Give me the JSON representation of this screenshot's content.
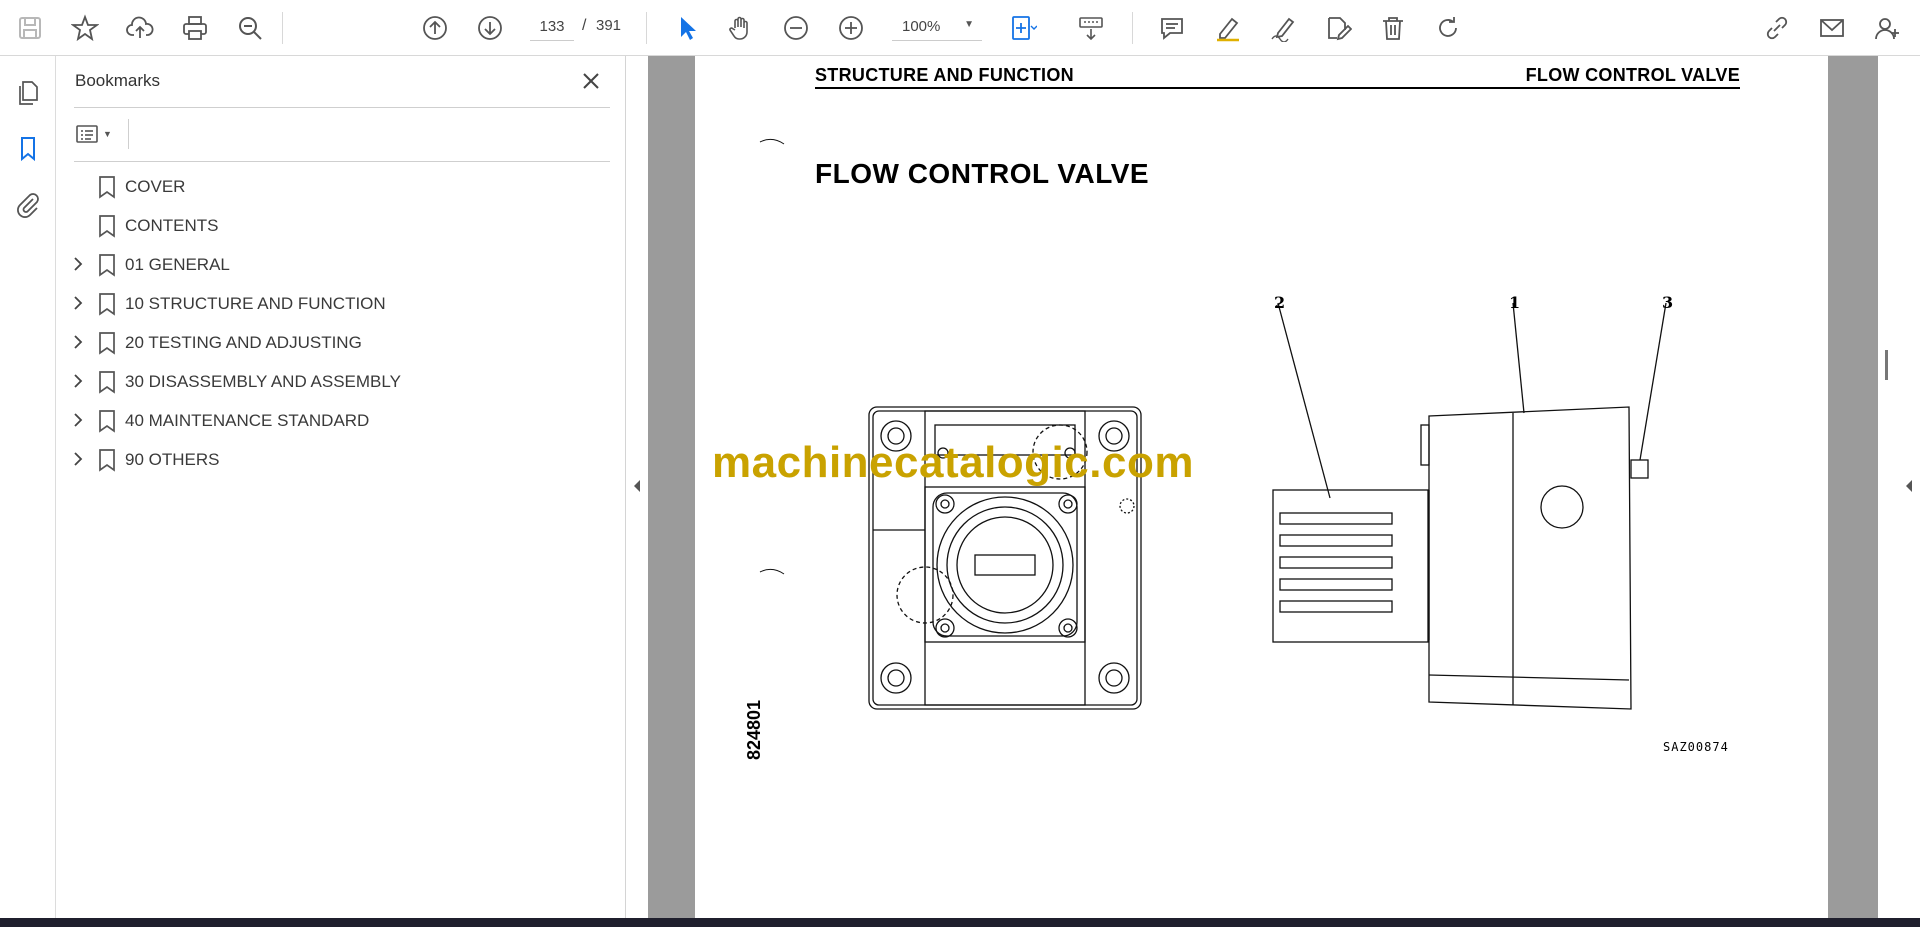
{
  "toolbar": {
    "current_page": "133",
    "page_separator": "/",
    "total_pages": "391",
    "zoom": "100%"
  },
  "panel": {
    "title": "Bookmarks"
  },
  "bookmarks": [
    {
      "label": "COVER",
      "expandable": false
    },
    {
      "label": "CONTENTS",
      "expandable": false
    },
    {
      "label": "01 GENERAL",
      "expandable": true
    },
    {
      "label": "10 STRUCTURE AND FUNCTION",
      "expandable": true
    },
    {
      "label": "20 TESTING AND ADJUSTING",
      "expandable": true
    },
    {
      "label": "30 DISASSEMBLY AND ASSEMBLY",
      "expandable": true
    },
    {
      "label": "40 MAINTENANCE STANDARD",
      "expandable": true
    },
    {
      "label": "90 OTHERS",
      "expandable": true
    }
  ],
  "document": {
    "header_left": "STRUCTURE AND FUNCTION",
    "header_right": "FLOW CONTROL VALVE",
    "title": "FLOW CONTROL VALVE",
    "watermark": "machinecatalogic.com",
    "figure_ref": "SAZ00874",
    "page_code": "824801",
    "callouts": {
      "c1": "1",
      "c2": "2",
      "c3": "3"
    }
  },
  "colors": {
    "accent_blue": "#1473e6",
    "watermark": "#c9a200",
    "viewer_bg": "#9b9b9b"
  }
}
